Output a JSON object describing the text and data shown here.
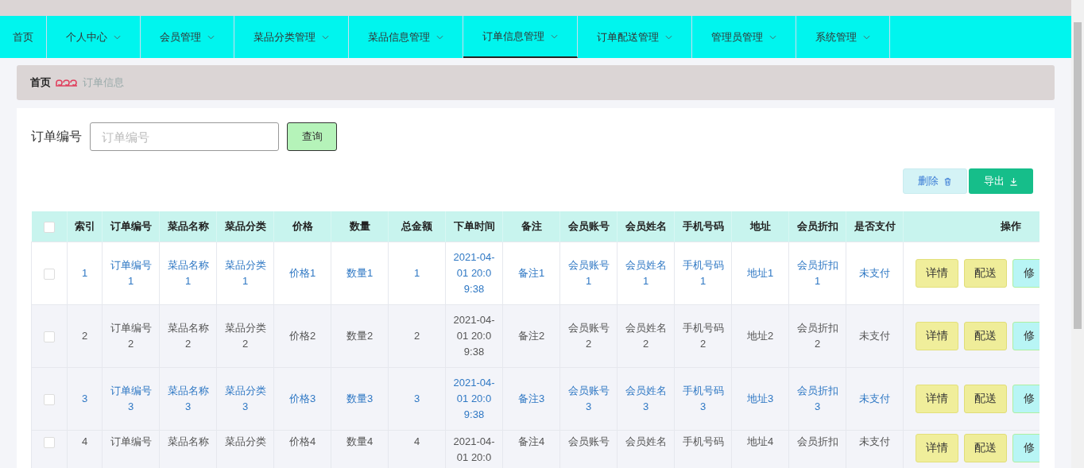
{
  "nav": [
    {
      "label": "首页",
      "dropdown": false,
      "selected": false
    },
    {
      "label": "个人中心",
      "dropdown": true,
      "selected": false
    },
    {
      "label": "会员管理",
      "dropdown": true,
      "selected": false
    },
    {
      "label": "菜品分类管理",
      "dropdown": true,
      "selected": false
    },
    {
      "label": "菜品信息管理",
      "dropdown": true,
      "selected": false
    },
    {
      "label": "订单信息管理",
      "dropdown": true,
      "selected": true
    },
    {
      "label": "订单配送管理",
      "dropdown": true,
      "selected": false
    },
    {
      "label": "管理员管理",
      "dropdown": true,
      "selected": false
    },
    {
      "label": "系统管理",
      "dropdown": true,
      "selected": false
    }
  ],
  "breadcrumb": {
    "home": "首页",
    "current": "订单信息"
  },
  "search": {
    "label": "订单编号",
    "placeholder": "订单编号",
    "button": "查询"
  },
  "toolbar": {
    "delete": "删除",
    "export": "导出"
  },
  "table": {
    "select_all_checked": false,
    "columns": [
      "索引",
      "订单编号",
      "菜品名称",
      "菜品分类",
      "价格",
      "数量",
      "总金额",
      "下单时间",
      "备注",
      "会员账号",
      "会员姓名",
      "手机号码",
      "地址",
      "会员折扣",
      "是否支付",
      "操作"
    ],
    "rows": [
      {
        "checked": false,
        "highlighted": true,
        "shaded": false,
        "partial": false,
        "cells": [
          "1",
          "订单编号1",
          "菜品名称1",
          "菜品分类1",
          "价格1",
          "数量1",
          "1",
          "2021-04-01 20:09:38",
          "备注1",
          "会员账号1",
          "会员姓名1",
          "手机号码1",
          "地址1",
          "会员折扣1",
          "未支付"
        ],
        "actions": [
          {
            "label": "详情",
            "kind": "detail"
          },
          {
            "label": "配送",
            "kind": "deliver"
          },
          {
            "label": "修",
            "kind": "edit"
          }
        ]
      },
      {
        "checked": false,
        "highlighted": false,
        "shaded": true,
        "partial": false,
        "cells": [
          "2",
          "订单编号2",
          "菜品名称2",
          "菜品分类2",
          "价格2",
          "数量2",
          "2",
          "2021-04-01 20:09:38",
          "备注2",
          "会员账号2",
          "会员姓名2",
          "手机号码2",
          "地址2",
          "会员折扣2",
          "未支付"
        ],
        "actions": [
          {
            "label": "详情",
            "kind": "detail"
          },
          {
            "label": "配送",
            "kind": "deliver"
          },
          {
            "label": "修",
            "kind": "edit"
          }
        ]
      },
      {
        "checked": false,
        "highlighted": true,
        "shaded": true,
        "partial": false,
        "cells": [
          "3",
          "订单编号3",
          "菜品名称3",
          "菜品分类3",
          "价格3",
          "数量3",
          "3",
          "2021-04-01 20:09:38",
          "备注3",
          "会员账号3",
          "会员姓名3",
          "手机号码3",
          "地址3",
          "会员折扣3",
          "未支付"
        ],
        "actions": [
          {
            "label": "详情",
            "kind": "detail"
          },
          {
            "label": "配送",
            "kind": "deliver"
          },
          {
            "label": "修",
            "kind": "edit"
          }
        ]
      },
      {
        "checked": false,
        "highlighted": false,
        "shaded": true,
        "partial": true,
        "cells": [
          "4",
          "订单编号",
          "菜品名称",
          "菜品分类",
          "价格4",
          "数量4",
          "4",
          "2021-04-01 20:0",
          "备注4",
          "会员账号",
          "会员姓名",
          "手机号码",
          "地址4",
          "会员折扣",
          "未支付"
        ],
        "actions": [
          {
            "label": "详情",
            "kind": "detail"
          },
          {
            "label": "配送",
            "kind": "deliver"
          },
          {
            "label": "修",
            "kind": "edit"
          }
        ]
      }
    ]
  }
}
